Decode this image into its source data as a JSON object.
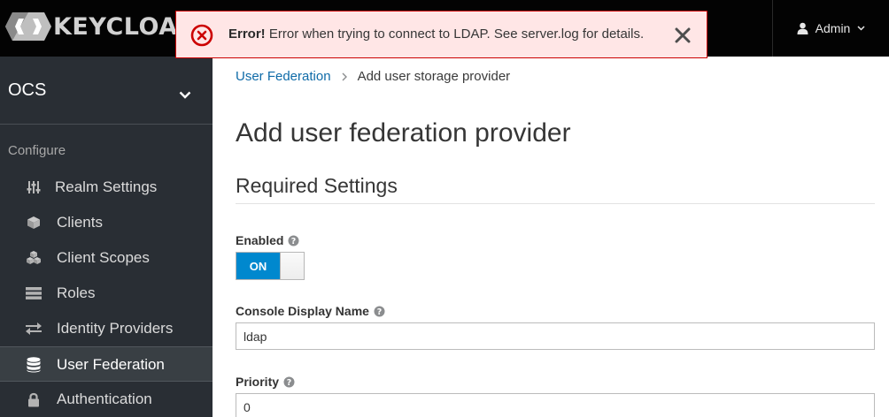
{
  "brand": {
    "name": "KEYCLOAK"
  },
  "user_menu": {
    "label": "Admin"
  },
  "alert": {
    "title": "Error!",
    "message": "Error when trying to connect to LDAP. See server.log for details."
  },
  "sidebar": {
    "realm": "OCS",
    "section_title": "Configure",
    "items": [
      {
        "label": "Realm Settings",
        "icon": "sliders-icon"
      },
      {
        "label": "Clients",
        "icon": "cube-icon"
      },
      {
        "label": "Client Scopes",
        "icon": "cubes-icon"
      },
      {
        "label": "Roles",
        "icon": "list-icon"
      },
      {
        "label": "Identity Providers",
        "icon": "exchange-icon"
      },
      {
        "label": "User Federation",
        "icon": "database-icon",
        "active": true
      },
      {
        "label": "Authentication",
        "icon": "lock-icon"
      }
    ]
  },
  "breadcrumb": {
    "parent": "User Federation",
    "current": "Add user storage provider"
  },
  "page": {
    "title": "Add user federation provider",
    "section": "Required Settings"
  },
  "form": {
    "enabled": {
      "label": "Enabled",
      "value": "ON"
    },
    "display_name": {
      "label": "Console Display Name",
      "value": "ldap"
    },
    "priority": {
      "label": "Priority",
      "value": "0"
    }
  },
  "colors": {
    "navbar": "#030303",
    "sidebar": "#292e34",
    "alert_bg": "#ffe6e6",
    "alert_border": "#cc0000",
    "link": "#0f6ba8",
    "switch_on": "#0088ce"
  }
}
